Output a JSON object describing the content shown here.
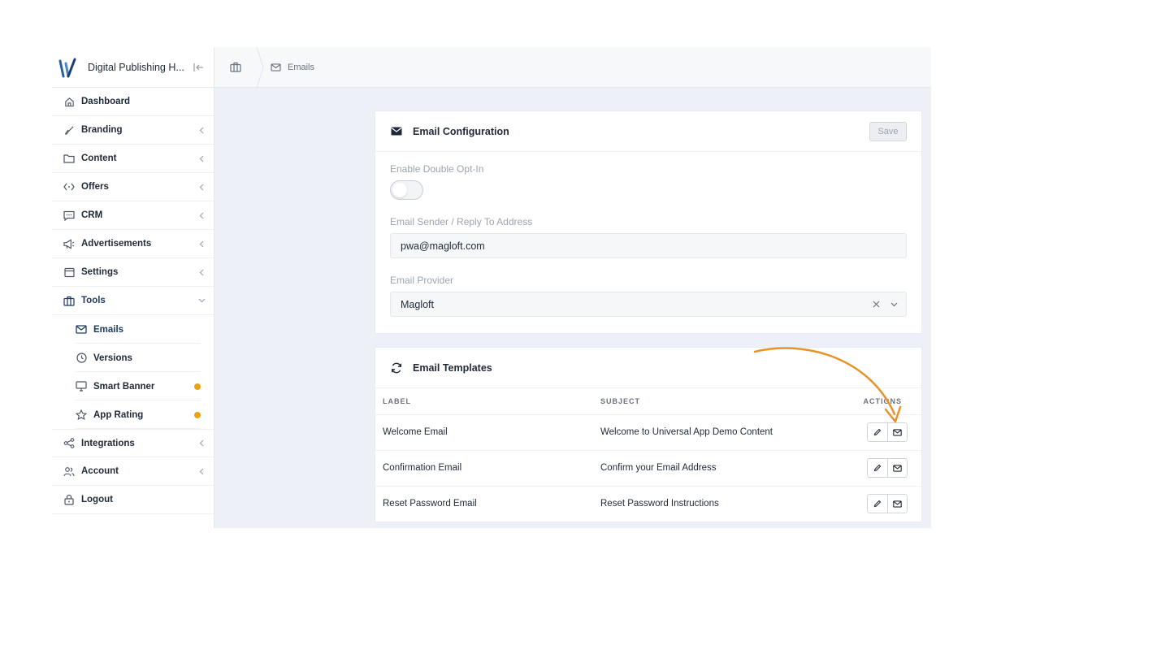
{
  "brand": {
    "name": "Digital Publishing H..."
  },
  "sidebar": {
    "items": [
      {
        "label": "Dashboard",
        "icon": "home-icon",
        "chevron": false
      },
      {
        "label": "Branding",
        "icon": "brush-icon",
        "chevron": true
      },
      {
        "label": "Content",
        "icon": "folder-icon",
        "chevron": true
      },
      {
        "label": "Offers",
        "icon": "tag-icon",
        "chevron": true
      },
      {
        "label": "CRM",
        "icon": "chat-icon",
        "chevron": true
      },
      {
        "label": "Advertisements",
        "icon": "megaphone-icon",
        "chevron": true
      },
      {
        "label": "Settings",
        "icon": "settings-icon",
        "chevron": true
      },
      {
        "label": "Tools",
        "icon": "toolbox-icon",
        "chevron": "down"
      }
    ],
    "subitems": [
      {
        "label": "Emails",
        "icon": "mail-icon",
        "active": true,
        "dot": false
      },
      {
        "label": "Versions",
        "icon": "clock-icon",
        "active": false,
        "dot": false
      },
      {
        "label": "Smart Banner",
        "icon": "monitor-icon",
        "active": false,
        "dot": true
      },
      {
        "label": "App Rating",
        "icon": "star-icon",
        "active": false,
        "dot": true
      }
    ],
    "bottom_items": [
      {
        "label": "Integrations",
        "icon": "share-icon",
        "chevron": true
      },
      {
        "label": "Account",
        "icon": "users-icon",
        "chevron": true
      },
      {
        "label": "Logout",
        "icon": "lock-icon",
        "chevron": false
      }
    ]
  },
  "breadcrumb": {
    "current": "Emails"
  },
  "config": {
    "title": "Email Configuration",
    "save_label": "Save",
    "double_optin_label": "Enable Double Opt-In",
    "double_optin_enabled": false,
    "sender_label": "Email Sender / Reply To Address",
    "sender_value": "pwa@magloft.com",
    "provider_label": "Email Provider",
    "provider_value": "Magloft"
  },
  "templates": {
    "title": "Email Templates",
    "columns": {
      "label": "LABEL",
      "subject": "SUBJECT",
      "actions": "ACTIONS"
    },
    "rows": [
      {
        "label": "Welcome Email",
        "subject": "Welcome to Universal App Demo Content"
      },
      {
        "label": "Confirmation Email",
        "subject": "Confirm your Email Address"
      },
      {
        "label": "Reset Password Email",
        "subject": "Reset Password Instructions"
      }
    ]
  },
  "colors": {
    "accent_dot": "#e8a317",
    "arrow": "#e8922a",
    "brand_blue": "#1e4e8c"
  }
}
